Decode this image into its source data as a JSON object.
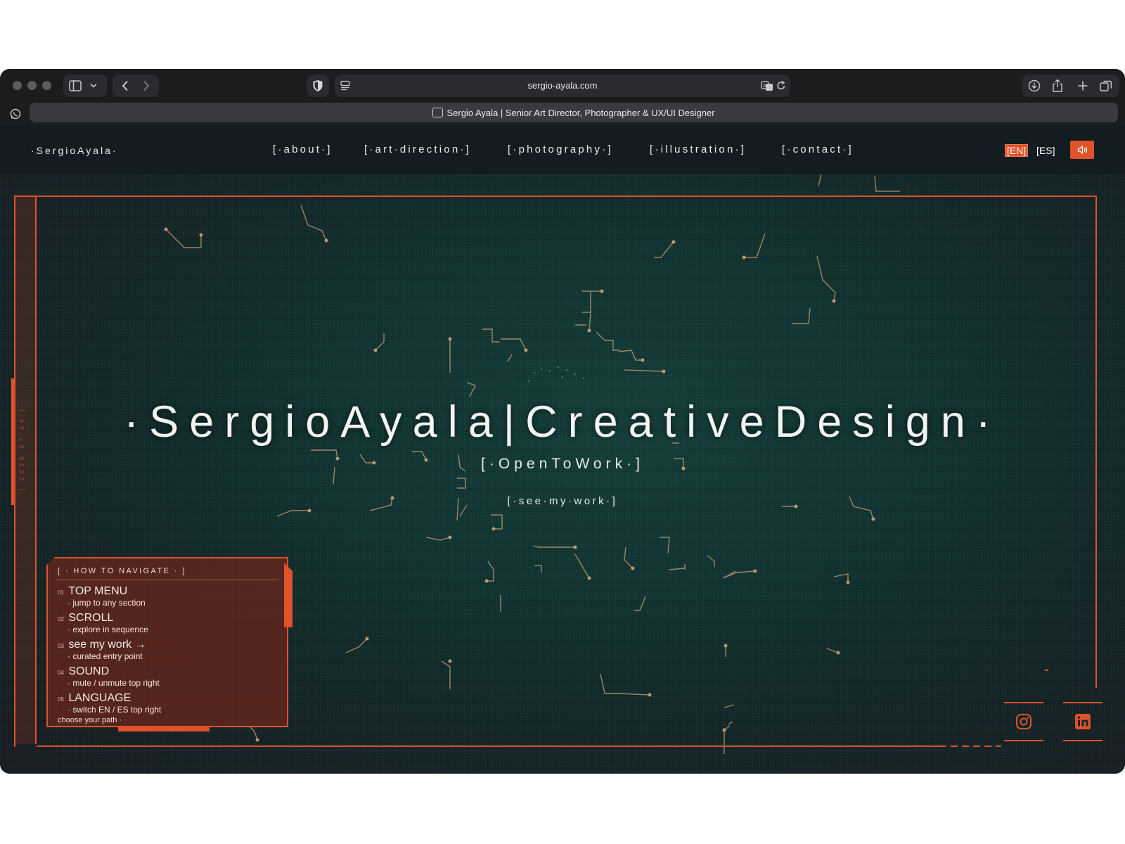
{
  "browser": {
    "url": "sergio-ayala.com",
    "tab_title": "Sergio Ayala | Senior Art Director, Photographer & UX/UI Designer"
  },
  "site": {
    "brand": "·SergioAyala·",
    "nav": [
      {
        "label": "[·about·]"
      },
      {
        "label": "[·art·direction·]"
      },
      {
        "label": "[·photography·]"
      },
      {
        "label": "[·illustration·]"
      },
      {
        "label": "[·contact·]"
      }
    ],
    "languages": [
      {
        "label": "[EN]",
        "active": true
      },
      {
        "label": "[ES]",
        "active": false
      }
    ],
    "sound_icon": "speaker-icon"
  },
  "hero": {
    "title": "·SergioAyala|CreativeDesign·",
    "subtitle": "[·OpenToWork·]",
    "cta": "[·see·my·work·]",
    "rail_text": "[·2026·07·14·]"
  },
  "help_panel": {
    "heading": "[ · HOW TO NAVIGATE · ]",
    "items": [
      {
        "num": "01",
        "title": "TOP MENU",
        "desc": "· jump to any section"
      },
      {
        "num": "02",
        "title": "SCROLL",
        "desc": "· explore in sequence"
      },
      {
        "num": "03",
        "title": "see my work →",
        "desc": "· curated entry point"
      },
      {
        "num": "04",
        "title": "SOUND",
        "desc": "· mute / unmute top right"
      },
      {
        "num": "05",
        "title": "LANGUAGE",
        "desc": "· switch EN / ES top right"
      }
    ],
    "footer": "choose your path ·"
  },
  "social": [
    {
      "icon": "instagram-icon"
    },
    {
      "icon": "linkedin-icon"
    }
  ],
  "colors": {
    "accent": "#e0522a",
    "hero_bg": "#133634",
    "circuit": "#c9a37a"
  }
}
